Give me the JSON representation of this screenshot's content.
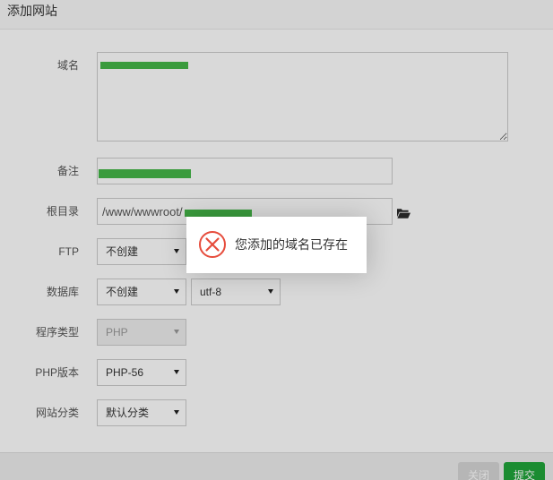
{
  "dialog": {
    "title": "添加网站",
    "fields": {
      "domain": {
        "label": "域名"
      },
      "remark": {
        "label": "备注"
      },
      "root_dir": {
        "label": "根目录",
        "value": "/www/wwwroot/"
      },
      "ftp": {
        "label": "FTP",
        "selected": "不创建"
      },
      "database": {
        "label": "数据库",
        "selected": "不创建",
        "charset_selected": "utf-8"
      },
      "program_type": {
        "label": "程序类型",
        "selected": "PHP",
        "disabled": true
      },
      "php_version": {
        "label": "PHP版本",
        "selected": "PHP-56"
      },
      "site_category": {
        "label": "网站分类",
        "selected": "默认分类"
      }
    },
    "buttons": {
      "close": "关闭",
      "submit": "提交"
    }
  },
  "alert": {
    "message": "您添加的域名已存在",
    "icon": "error-circle-x-icon"
  },
  "icons": {
    "root_dir_picker": "folder-open-icon",
    "select_caret": "caret-down-icon"
  },
  "colors": {
    "accent_green": "#20a53a",
    "error_red": "#e64c3c",
    "redaction_green": "#3a9b3d",
    "modal_overlay": "rgba(0,0,0,0.15)"
  }
}
